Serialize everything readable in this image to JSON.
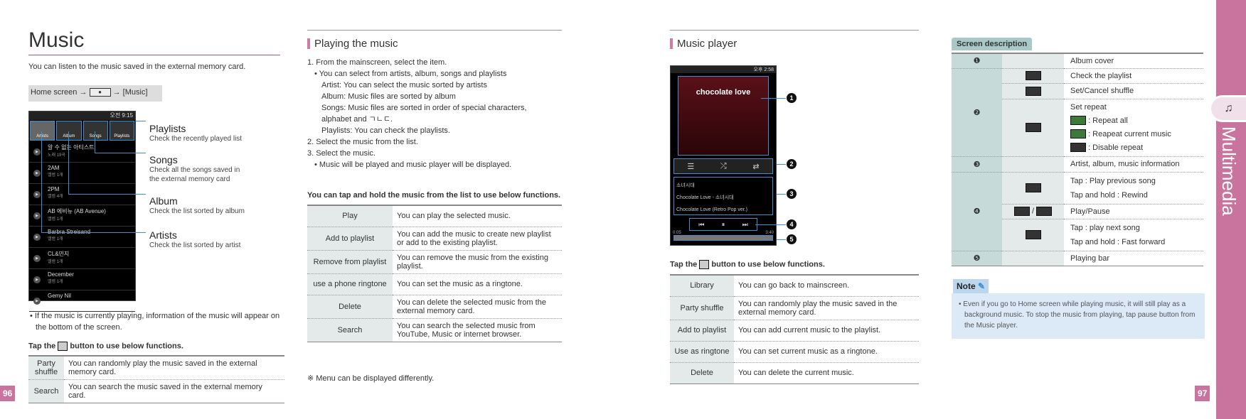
{
  "left": {
    "title": "Music",
    "intro": "You can listen to the music saved in the external memory card.",
    "path": {
      "prefix": "Home screen →",
      "suffix": "→ [Music]"
    },
    "phone": {
      "time": "오전 9:15",
      "tabs": [
        "Artists",
        "Album",
        "Songs",
        "Playlists"
      ],
      "items": [
        {
          "name": "알 수 없는 아티스트",
          "sub": "노래 19곡"
        },
        {
          "name": "2AM",
          "sub": "앨범 1개"
        },
        {
          "name": "2PM",
          "sub": "앨범 4개"
        },
        {
          "name": "AB 에비뉴 (AB Avenue)",
          "sub": "앨범 1개"
        },
        {
          "name": "Barbra Streisand",
          "sub": "앨범 1개"
        },
        {
          "name": "CL&민지",
          "sub": "앨범 1개"
        },
        {
          "name": "December",
          "sub": "앨범 1개"
        },
        {
          "name": "Gemy Nil",
          "sub": ""
        }
      ]
    },
    "callouts": [
      {
        "title": "Playlists",
        "desc": "Check the recently played list"
      },
      {
        "title": "Songs",
        "desc": "Check all the songs saved in the external memory card"
      },
      {
        "title": "Album",
        "desc": "Check the list sorted by album"
      },
      {
        "title": "Artists",
        "desc": "Check the list sorted by artist"
      }
    ],
    "bullet": "If the music is currently playing, information of the music will appear on the bottom of the screen.",
    "tap_prefix": "Tap the",
    "tap_suffix": "button to use below functions.",
    "table": [
      {
        "k": "Party shuffle",
        "v": "You can randomly play the music saved in the external memory card."
      },
      {
        "k": "Search",
        "v": "You can search the music saved in the external memory card."
      }
    ],
    "page": "96"
  },
  "playing": {
    "heading": "Playing the music",
    "step1": "1. From the mainscreen, select the item.",
    "step1_bullet": "You can select from artists, album, songs and playlists",
    "step1_lines": [
      "Artist: You can select the music sorted by artists",
      "Album: Music files are sorted by album",
      "Songs: Music files are sorted in order of special characters,",
      "alphabet and ㄱㄴㄷ.",
      "Playlists: You can check the playlists."
    ],
    "step2": "2. Select the music from the list.",
    "step3": "3. Select the music.",
    "step3_bullet": "Music will be played and music player will be displayed.",
    "tap_hold": "You can tap and hold the music from the list to use below functions.",
    "table": [
      {
        "k": "Play",
        "v": "You can play the selected music."
      },
      {
        "k": "Add to playlist",
        "v": "You can add the music to create new playlist or add to the existing playlist."
      },
      {
        "k": "Remove from playlist",
        "v": "You can remove the music from the existing playlist."
      },
      {
        "k": "use a phone ringtone",
        "v": "You can set the music as a ringtone."
      },
      {
        "k": "Delete",
        "v": "You can delete the selected music from the external memory card."
      },
      {
        "k": "Search",
        "v": "You can search the selected music from YouTube, Music or internet browser."
      }
    ],
    "footnote": "※ Menu can be displayed differently."
  },
  "player": {
    "heading": "Music player",
    "phone": {
      "time": "오후 2:58",
      "album": "chocolate love",
      "artist": "소녀시대",
      "album_line": "Chocolate Love - 소녀시대",
      "song": "Chocolate Love (Retro Pop ver.)",
      "elapsed": "0:05",
      "total": "3:40"
    },
    "markers": [
      "1",
      "2",
      "3",
      "4",
      "5"
    ],
    "tap_prefix": "Tap the",
    "tap_suffix": "button to use below functions.",
    "table": [
      {
        "k": "Library",
        "v": "You can go back to mainscreen."
      },
      {
        "k": "Party shuffle",
        "v": "You can randomly play the music saved in the external memory card."
      },
      {
        "k": "Add to playlist",
        "v": "You can add current music to the playlist."
      },
      {
        "k": "Use as ringtone",
        "v": "You can set current music as a ringtone."
      },
      {
        "k": "Delete",
        "v": "You can delete the current music."
      }
    ]
  },
  "screen": {
    "tab": "Screen description",
    "album_cover": "Album cover",
    "check_playlist": "Check the playlist",
    "shuffle": "Set/Cancel shuffle",
    "repeat": "Set repeat",
    "repeat_all": ": Repeat all",
    "repeat_one": ": Reapeat current music",
    "repeat_off": ": Disable repeat",
    "info": "Artist, album, music information",
    "prev1": "Tap : Play previous song",
    "prev2": "Tap and hold : Rewind",
    "playpause": "Play/Pause",
    "next1": "Tap : play next song",
    "next2": "Tap and hold : Fast forward",
    "bar": "Playing bar",
    "n": [
      "❶",
      "❷",
      "❸",
      "❹",
      "❺"
    ]
  },
  "note": {
    "label": "Note",
    "text": "Even if you go to Home screen while playing music, it will still play as a background music. To stop the music from playing, tap pause button from the Music player."
  },
  "side": {
    "label": "Multimedia",
    "color": "#c8749f"
  },
  "page_right": "97"
}
